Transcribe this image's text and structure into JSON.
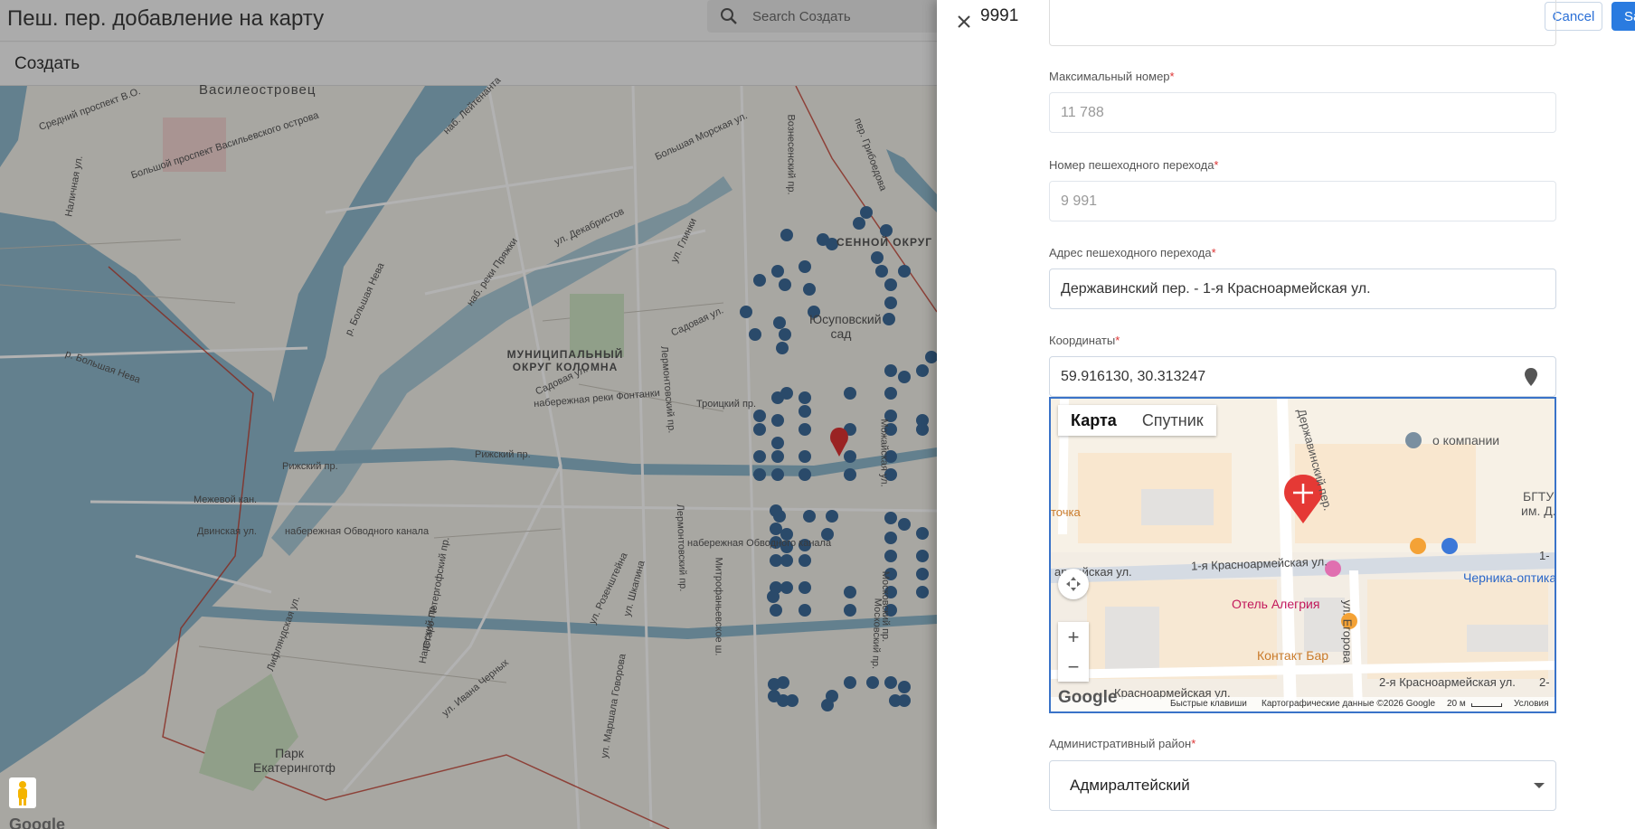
{
  "background_app": {
    "title": "Пеш. пер. добавление на карту",
    "search_placeholder": "Search Создать",
    "subtitle": "Создать",
    "map_labels": {
      "vasileostrovets": "Василеостровец",
      "sredny": "Средний проспект В.О.",
      "bolshoy": "Большой проспект Васильевского острова",
      "nab_leytenanta": "наб. Лейтенанта",
      "bolshaya_morskaya": "Большая Морская ул.",
      "voznesensky": "Вознесенский пр.",
      "griboedova": "пер. Грибоедова",
      "dekabristov": "ул. Декабристов",
      "glinki": "ул. Глинки",
      "pryazhki": "наб. реки Пряжки",
      "b_neva": "р. Большая Нева",
      "sadovaya1": "Садовая ул.",
      "sadovaya2": "Садовая ул.",
      "fontanki": "набережная реки Фонтанки",
      "troitsky": "Троицкий пр.",
      "lermontovsky1": "Лермонтовский пр.",
      "lermontovsky2": "Лермонтовский пр.",
      "rizhsky1": "Рижский пр.",
      "rizhsky2": "Рижский пр.",
      "mezhevoy": "Межевой кан.",
      "dvinskaya": "Двинская ул.",
      "obvodnogo1": "набережная Обводного канала",
      "obvodnogo2": "набережная Обводного канала",
      "staro_peterhof": "Старо-Петергофский пр.",
      "rozenshteina": "ул. Розенштейна",
      "shkapina": "ул. Шкапина",
      "mitrofanyevskoe": "Митрофаньевское ш.",
      "moskovsky": "Московский пр.",
      "narvsky": "Нарвский пр.",
      "lifl": "Лифляндская ул.",
      "ivana_chernykh": "ул. Ивана Черных",
      "govorova": "ул. Маршала Говорова",
      "mozhaiskaya": "Можайская ул.",
      "moskovsky2": "Московский пр.",
      "yusupov": "Юсуповский сад",
      "park": "Парк Екатеринготф",
      "kolomna": "МУНИЦИПАЛЬНЫЙ ОКРУГ КОЛОМНА",
      "sennoy": "СЕННОЙ ОКРУГ",
      "google": "Google",
      "nalichnaya": "Наличная ул."
    }
  },
  "drawer": {
    "title": "9991",
    "cancel_label": "Cancel",
    "save_label": "Sa",
    "fields": {
      "max_number": {
        "label": "Максимальный номер",
        "required": "*",
        "value": "11 788"
      },
      "crossing_number": {
        "label": "Номер пешеходного перехода",
        "required": "*",
        "value": "9 991"
      },
      "address": {
        "label": "Адрес пешеходного перехода",
        "required": "*",
        "value": "Державинский пер. - 1-я Красноармейская ул."
      },
      "coordinates": {
        "label": "Координаты",
        "required": "*",
        "value": "59.916130, 30.313247"
      },
      "district": {
        "label": "Административный район",
        "required": "*",
        "value": "Адмиралтейский"
      }
    },
    "mini_map": {
      "map_type_map": "Карта",
      "map_type_satellite": "Спутник",
      "zoom_in": "+",
      "zoom_out": "−",
      "labels": {
        "o_kompanii": "о компании",
        "bgtu": "БГТУ",
        "im_d": "им. Д.",
        "tochka": "точка",
        "derzhavin": "Державинский пер.",
        "kr1_left": "армейская ул.",
        "kr1": "1-я Красноармейская ул.",
        "kr1_right": "1-",
        "egorova": "ул. Егорова",
        "alegria": "Отель Алегрия",
        "chernika": "Черника-оптика",
        "kontakt": "Контакт Бар",
        "kr_bottom": "Красноармейская ул.",
        "kr2": "2-я Красноармейская ул.",
        "kr2_right": "2-"
      },
      "google": "Google",
      "shortcuts": "Быстрые клавиши",
      "map_data": "Картографические данные ©2026 Google",
      "scale": "20 м",
      "terms": "Условия"
    }
  },
  "colors": {
    "accent": "#2a7be0",
    "water": "#8fb8cc",
    "pin_red": "#e53935",
    "marker_blue": "#3d6a99"
  }
}
